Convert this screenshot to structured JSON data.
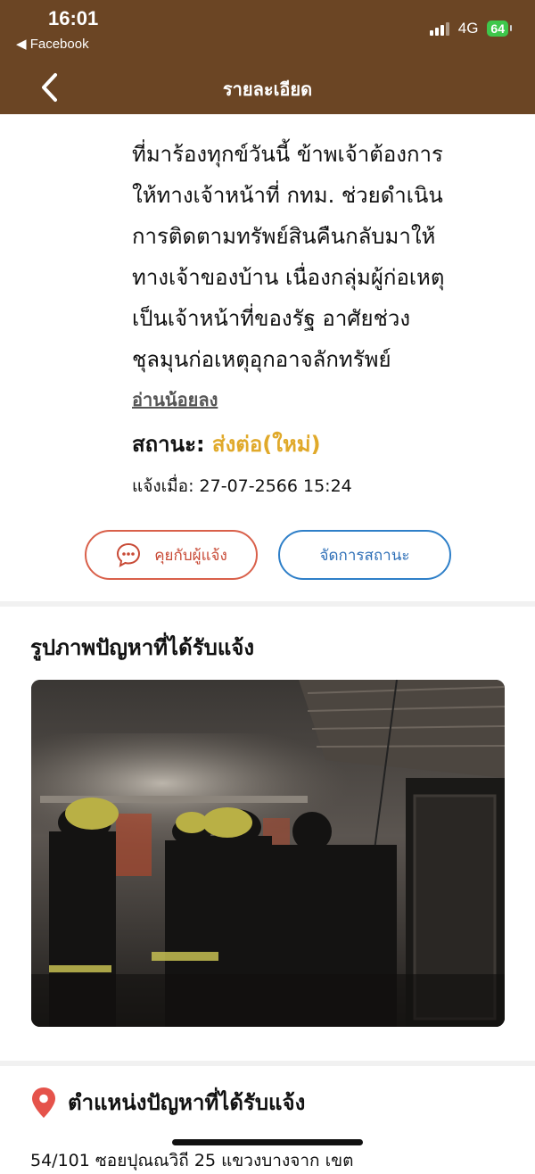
{
  "status_bar": {
    "time": "16:01",
    "back_app": "◀ Facebook",
    "network": "4G",
    "battery": "64"
  },
  "header": {
    "title": "รายละเอียด"
  },
  "description": {
    "lines": [
      "ที่มาร้องทุกข์วันนี้ ข้าพเจ้าต้องการ",
      "ให้ทางเจ้าหน้าที่ กทม. ช่วยดำเนิน",
      "การติดตามทรัพย์สินคืนกลับมาให้",
      "ทางเจ้าของบ้าน เนื่องกลุ่มผู้ก่อเหตุ",
      "เป็นเจ้าหน้าที่ของรัฐ อาศัยช่วง",
      "ชุลมุนก่อเหตุอุกอาจลักทรัพย์"
    ],
    "read_less": "อ่านน้อยลง"
  },
  "status": {
    "label": "สถานะ:",
    "value": "ส่งต่อ(ใหม่)"
  },
  "reported": {
    "label": "แจ้งเมื่อ:",
    "value": "27-07-2566 15:24"
  },
  "buttons": {
    "chat": "คุยกับผู้แจ้ง",
    "manage": "จัดการสถานะ"
  },
  "photo_section": {
    "title": "รูปภาพปัญหาที่ได้รับแจ้ง"
  },
  "location_section": {
    "title": "ตำแหน่งปัญหาที่ได้รับแจ้ง",
    "address": "54/101 ซอยปุณณวิถี 25 แขวงบางจาก เขต"
  },
  "colors": {
    "header_bg": "#6b4524",
    "status_value": "#e0a92a",
    "chat_border": "#d9604a",
    "manage_border": "#2e7fc8",
    "pin": "#e5534b"
  }
}
